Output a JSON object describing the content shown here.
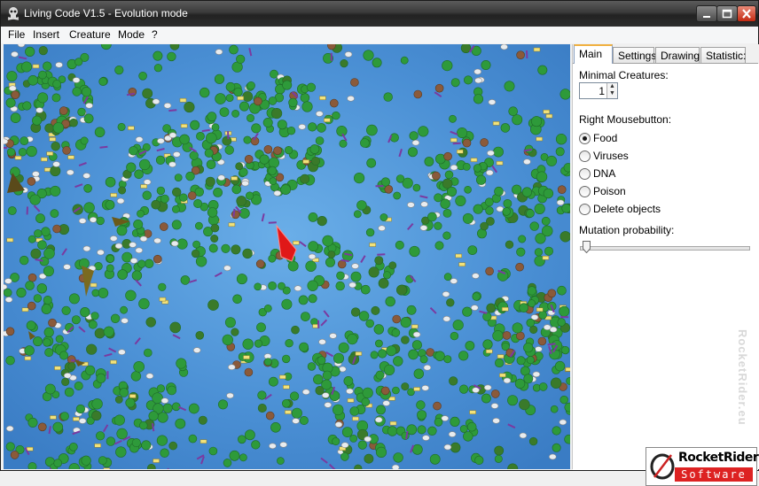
{
  "window": {
    "title": "Living Code V1.5  - Evolution mode"
  },
  "menu": [
    "File",
    "Insert",
    "Creature",
    "Mode",
    "?"
  ],
  "tabs": [
    "Main",
    "Settings",
    "Drawing",
    "Statistic:"
  ],
  "active_tab": "Main",
  "main": {
    "minimal_creatures_label": "Minimal Creatures:",
    "minimal_creatures_value": "1",
    "right_mouse_label": "Right Mousebutton:",
    "right_mouse_options": [
      "Food",
      "Viruses",
      "DNA",
      "Poison",
      "Delete objects"
    ],
    "right_mouse_selected": "Food",
    "mutation_label": "Mutation probability:",
    "mutation_probability_fraction": 0.0
  },
  "branding": {
    "logo_top": "RocketRider",
    "logo_bottom": "Software",
    "watermark": "RocketRider.eu"
  },
  "colors": {
    "water": "#4a8fd4",
    "food": "#2e9a3a",
    "creature": "#e01818",
    "close_button": "#c42a12"
  },
  "icons": {
    "app": "skull-icon",
    "minimize": "minimize-icon",
    "maximize": "maximize-icon",
    "close": "close-icon"
  }
}
